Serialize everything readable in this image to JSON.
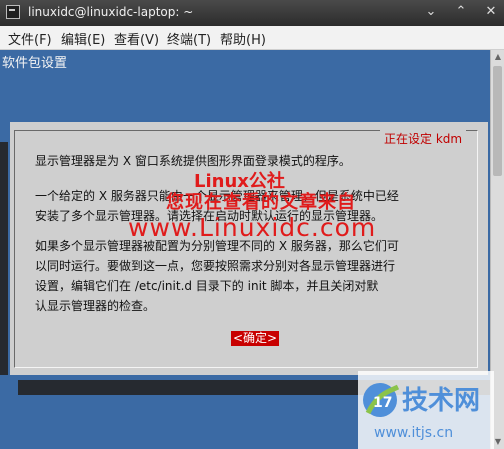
{
  "window": {
    "title": "linuxidc@linuxidc-laptop: ~",
    "controls": [
      "minimize-icon",
      "maximize-icon",
      "close-icon"
    ]
  },
  "menu": {
    "items": [
      "文件(F)",
      "编辑(E)",
      "查看(V)",
      "终端(T)",
      "帮助(H)"
    ]
  },
  "terminal": {
    "header": "软件包设置"
  },
  "dialog": {
    "title": "正在设定 kdm",
    "paragraphs": [
      "显示管理器是为 X 窗口系统提供图形界面登录模式的程序。",
      "一个给定的 X 服务器只能由一个显示管理器来管理，但是系统中已经\n安装了多个显示管理器。请选择在启动时默认运行的显示管理器。",
      "如果多个显示管理器被配置为分别管理不同的 X 服务器，那么它们可\n以同时运行。要做到这一点，您要按照需求分别对各显示管理器进行\n设置，编辑它们在 /etc/init.d 目录下的 init 脚本，并且关闭对默\n认显示管理器的检查。"
    ],
    "ok_button": "<确定>"
  },
  "watermark": {
    "line1": "Linux公社",
    "line2": "您现在查看的文章来自",
    "line3": "www.Linuxidc.com"
  },
  "logo": {
    "brand": "技术网",
    "url": "www.itjs.cn"
  },
  "colors": {
    "terminal_bg": "#3b6aa4",
    "dialog_bg": "#cfcfcf",
    "accent_red": "#c80000"
  }
}
